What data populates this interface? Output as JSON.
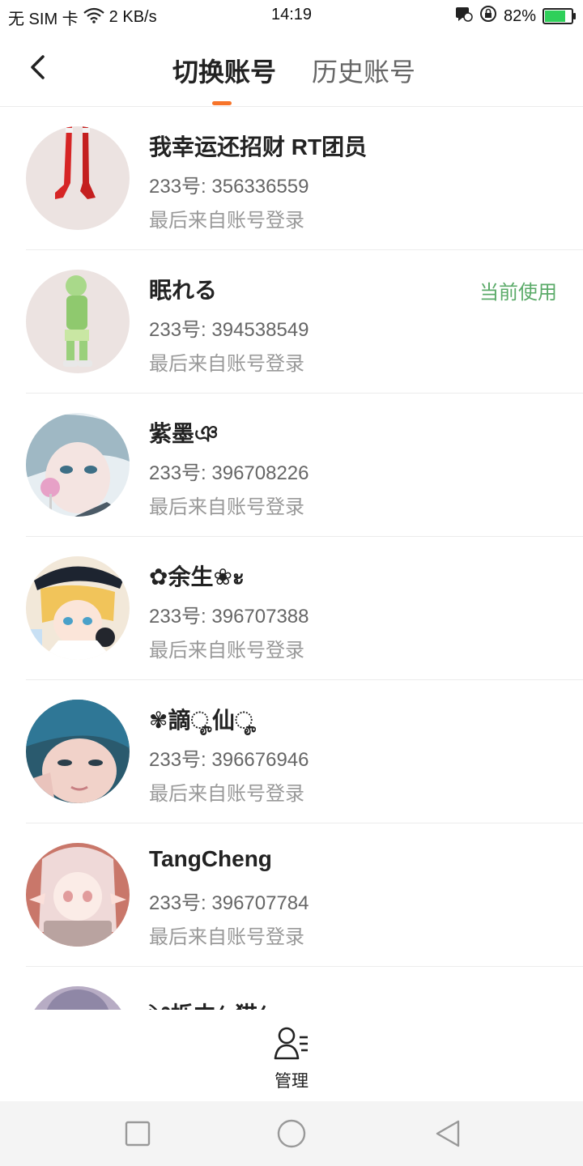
{
  "status_bar": {
    "sim": "无 SIM 卡",
    "speed": "2 KB/s",
    "time": "14:19",
    "battery": "82%",
    "battery_level": 0.82,
    "battery_color": "#2fd05a"
  },
  "header": {
    "back_icon": "chevron-left-icon",
    "tabs": [
      {
        "label": "切换账号",
        "active": true
      },
      {
        "label": "历史账号",
        "active": false
      }
    ],
    "accent": "#f7742a"
  },
  "accounts": [
    {
      "name": "我幸运还招财 RT团员",
      "uid": "233号: 356336559",
      "login": "最后来自账号登录",
      "current": "",
      "avatar": "red-boots-avatar"
    },
    {
      "name": "眠れる",
      "uid": "233号: 394538549",
      "login": "最后来自账号登录",
      "current": "当前使用",
      "avatar": "green-character-avatar"
    },
    {
      "name": "紫墨ঞ",
      "uid": "233号: 396708226",
      "login": "最后来自账号登录",
      "current": "",
      "avatar": "anime-boy-lollipop-avatar"
    },
    {
      "name": "✿余生❀ะ",
      "uid": "233号: 396707388",
      "login": "最后来自账号登录",
      "current": "",
      "avatar": "anime-girl-cap-avatar"
    },
    {
      "name": "✾謫ೄ仙ೄ",
      "uid": "233号: 396676946",
      "login": "最后来自账号登录",
      "current": "",
      "avatar": "blue-hair-boy-avatar"
    },
    {
      "name": "TangCheng",
      "uid": "233号: 396707784",
      "login": "最后来自账号登录",
      "current": "",
      "avatar": "pink-hair-girl-avatar"
    },
    {
      "name": "༄栎中ꦿ猫ꦿ",
      "uid": "",
      "login": "",
      "current": "",
      "avatar": "purple-avatar"
    }
  ],
  "manage": {
    "label": "管理",
    "icon": "user-manage-icon"
  },
  "nav": {
    "icons": [
      "recent-apps-icon",
      "home-icon",
      "back-icon"
    ]
  }
}
